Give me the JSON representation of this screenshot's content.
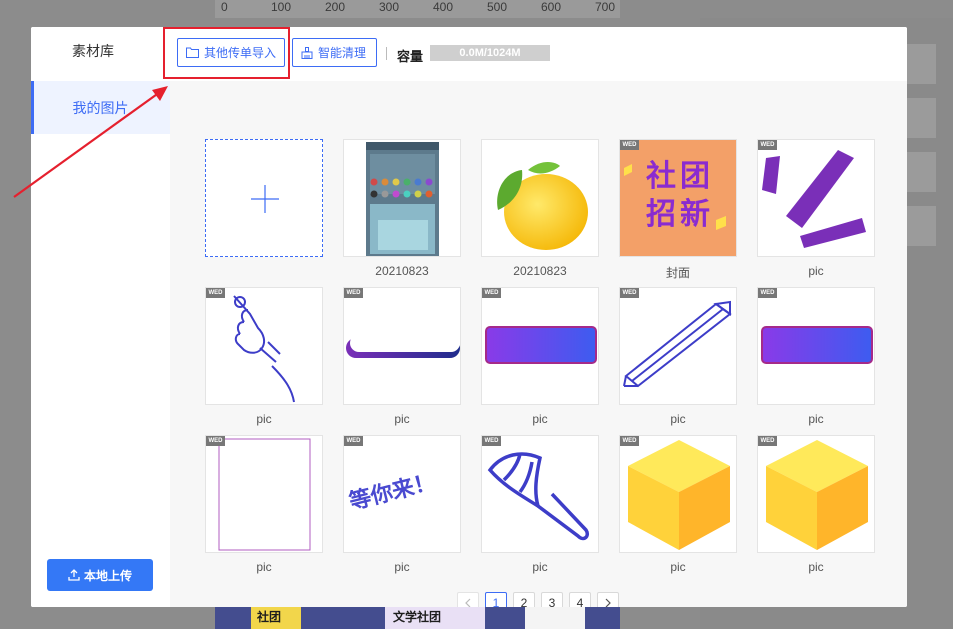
{
  "background": {
    "ruler_ticks": [
      "0",
      "100",
      "200",
      "300",
      "400",
      "500",
      "600",
      "700"
    ],
    "bottom_texts": [
      "社团",
      "文学社团"
    ]
  },
  "modal": {
    "sidebar": {
      "title": "素材库",
      "nav_items": [
        {
          "label": "我的图片",
          "active": true
        }
      ],
      "upload_label": "本地上传"
    },
    "header": {
      "import_label": "其他传单导入",
      "clean_label": "智能清理",
      "capacity_label": "容量",
      "capacity_value": "0.0M/1024M",
      "capacity_used_percent": 0
    },
    "grid": {
      "items": [
        {
          "type": "add",
          "caption": "",
          "badge": ""
        },
        {
          "type": "screenshot",
          "caption": "20210823",
          "badge": ""
        },
        {
          "type": "lemon",
          "caption": "20210823",
          "badge": ""
        },
        {
          "type": "poster",
          "caption": "封面",
          "badge": "WED",
          "poster_text": [
            "社",
            "团",
            "招",
            "新"
          ]
        },
        {
          "type": "purple-rays",
          "caption": "pic",
          "badge": "WED"
        },
        {
          "type": "hand",
          "caption": "pic",
          "badge": "WED"
        },
        {
          "type": "bar-white",
          "caption": "pic",
          "badge": "WED"
        },
        {
          "type": "gradient-rect",
          "caption": "pic",
          "badge": "WED"
        },
        {
          "type": "pencil",
          "caption": "pic",
          "badge": "WED"
        },
        {
          "type": "gradient-rect",
          "caption": "pic",
          "badge": "WED"
        },
        {
          "type": "frame",
          "caption": "pic",
          "badge": "WED"
        },
        {
          "type": "text-art",
          "caption": "pic",
          "badge": "WED",
          "art_text": "等你来！"
        },
        {
          "type": "shuttlecock",
          "caption": "pic",
          "badge": "WED"
        },
        {
          "type": "cube",
          "caption": "pic",
          "badge": "WED"
        },
        {
          "type": "cube",
          "caption": "pic",
          "badge": "WED"
        }
      ]
    },
    "pagination": {
      "pages": [
        "1",
        "2",
        "3",
        "4"
      ],
      "current": "1",
      "prev_icon": "chevron-left-icon",
      "next_icon": "chevron-right-icon"
    }
  },
  "colors": {
    "primary": "#3d6cf5",
    "upload_button": "#3478f6",
    "annotation_red": "#e5202e",
    "purple": "#7a2fb8"
  }
}
